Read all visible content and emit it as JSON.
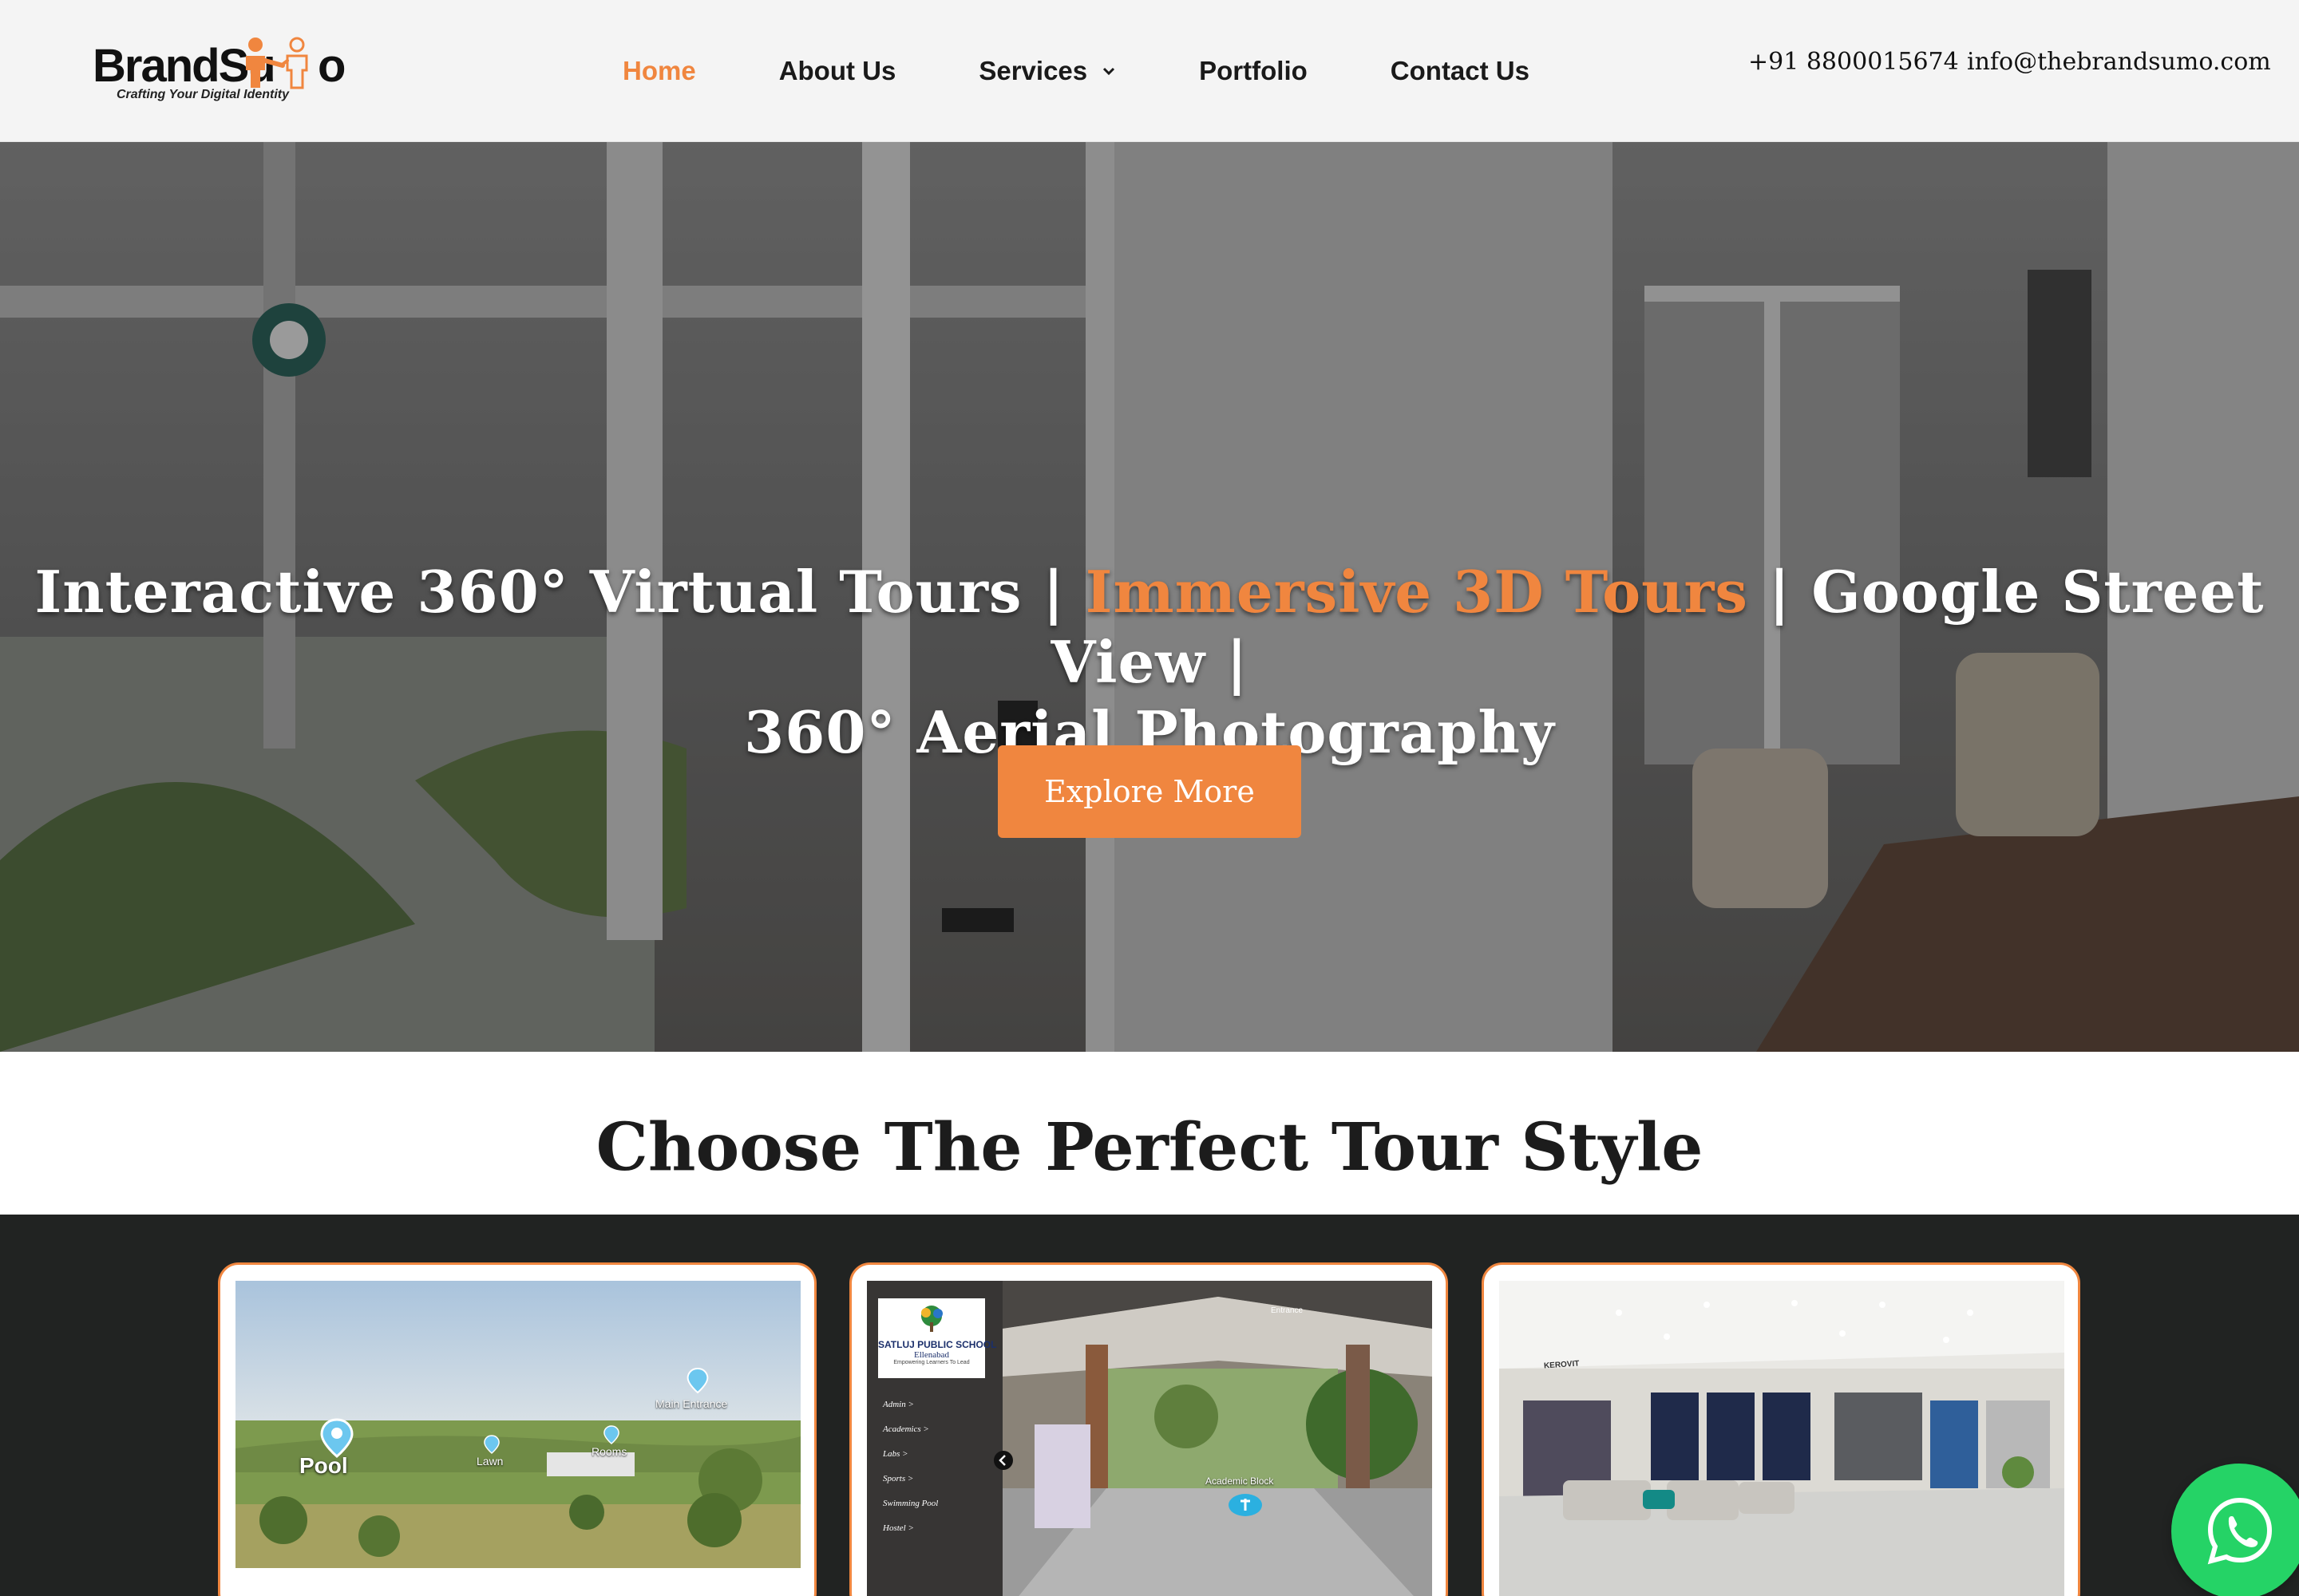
{
  "brand": {
    "logo_text_left": "BrandSu",
    "logo_text_right": "o",
    "tagline": "Crafting Your Digital Identity"
  },
  "nav": {
    "items": [
      {
        "label": "Home",
        "active": true
      },
      {
        "label": "About Us",
        "active": false
      },
      {
        "label": "Services",
        "active": false,
        "has_dropdown": true
      },
      {
        "label": "Portfolio",
        "active": false
      },
      {
        "label": "Contact Us",
        "active": false
      }
    ]
  },
  "contact": {
    "phone": "+91 8800015674",
    "email": "info@thebrandsumo.com"
  },
  "hero": {
    "title_part1": "Interactive 360° Virtual Tours | ",
    "title_highlight": "Immersive 3D Tours",
    "title_part2": " | Google Street View |",
    "title_line2": "360° Aerial Photography",
    "cta_label": "Explore More"
  },
  "section": {
    "title": "Choose The Perfect Tour Style"
  },
  "cards": [
    {
      "hotspots": [
        "Main Entrance",
        "Pool",
        "Lawn",
        "Rooms"
      ]
    },
    {
      "school_name": "SATLUJ PUBLIC SCHOOL",
      "school_city": "Ellenabad",
      "school_motto": "Empowering Learners To Lead",
      "menu": [
        "Admin >",
        "Academics >",
        "Labs >",
        "Sports >",
        "Swimming Pool",
        "Hostel >"
      ],
      "scene_label": "Academic Block",
      "top_label": "Entrance"
    },
    {
      "brand_sign": "KEROVIT"
    }
  ],
  "colors": {
    "accent": "#f0863f",
    "header_bg": "#f4f4f4",
    "dark_bg": "#212322",
    "whatsapp": "#25d366"
  },
  "icons": {
    "dropdown": "chevron-down-icon",
    "whatsapp": "whatsapp-icon"
  }
}
